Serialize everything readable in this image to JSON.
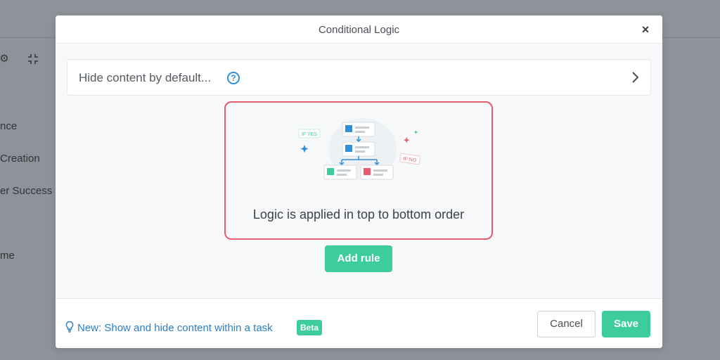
{
  "background": {
    "sidebar_items": [
      "nce",
      "Creation",
      "er Success",
      "me"
    ],
    "icons": [
      "gear-icon",
      "collapse-icon"
    ]
  },
  "modal": {
    "title": "Conditional Logic",
    "close_label": "×",
    "hide_row": {
      "label": "Hide content by default...",
      "help_label": "?"
    },
    "empty_state": {
      "tag_yes": "IF YES",
      "tag_no": "IF NO",
      "text": "Logic is applied in top to bottom order"
    },
    "add_rule_label": "Add rule",
    "footer": {
      "new_link": "New: Show and hide content within a task",
      "beta_badge": "Beta",
      "cancel_label": "Cancel",
      "save_label": "Save"
    }
  },
  "colors": {
    "accent_green": "#3dcc9b",
    "link_blue": "#2a7fc8",
    "highlight_red": "#e85a70"
  }
}
